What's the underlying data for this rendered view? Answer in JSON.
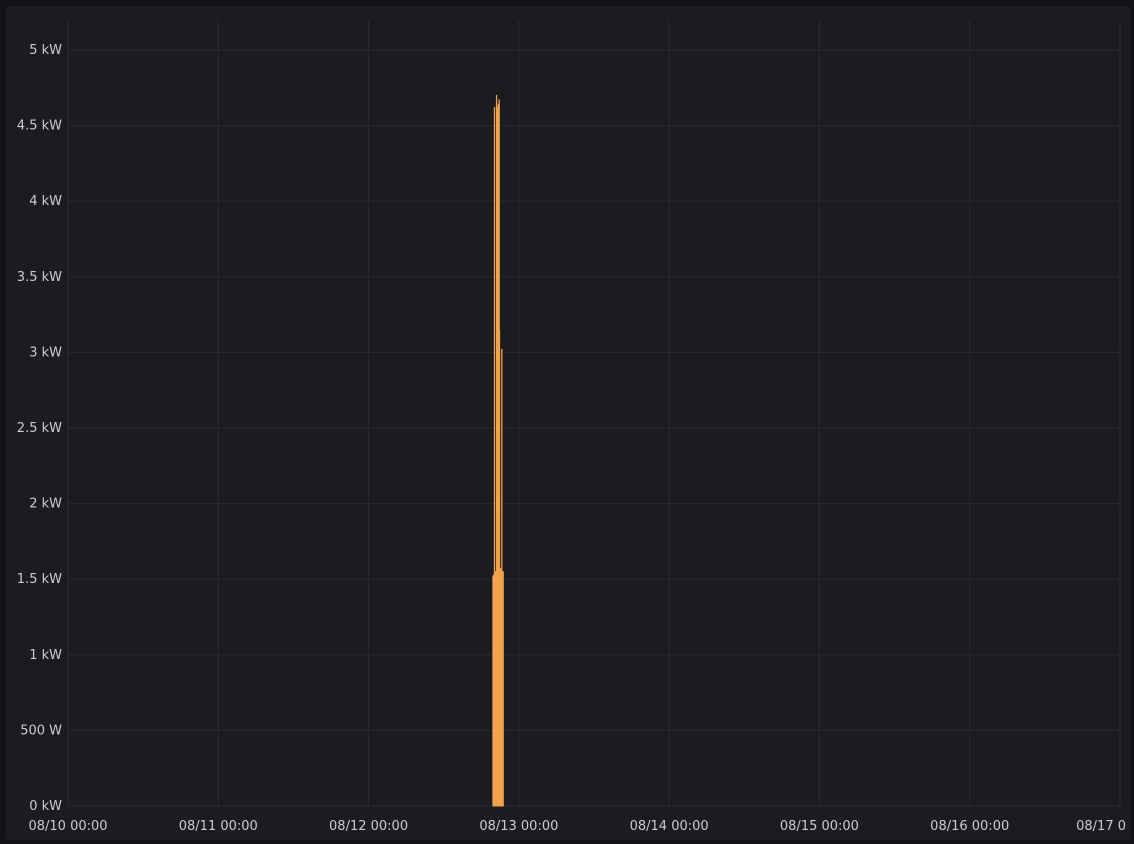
{
  "chart_data": {
    "type": "area",
    "title": "",
    "xlabel": "",
    "ylabel": "",
    "series": [
      {
        "color": "#f2a24b",
        "points": [
          {
            "x": "08/12 19:50",
            "y": 0
          },
          {
            "x": "08/12 19:51",
            "y": 1520
          },
          {
            "x": "08/12 20:00",
            "y": 1530
          },
          {
            "x": "08/12 20:05",
            "y": 4620
          },
          {
            "x": "08/12 20:08",
            "y": 1540
          },
          {
            "x": "08/12 20:15",
            "y": 1550
          },
          {
            "x": "08/12 20:25",
            "y": 4700
          },
          {
            "x": "08/12 20:28",
            "y": 1560
          },
          {
            "x": "08/12 20:35",
            "y": 4620
          },
          {
            "x": "08/12 20:38",
            "y": 1570
          },
          {
            "x": "08/12 20:42",
            "y": 4640
          },
          {
            "x": "08/12 20:45",
            "y": 1560
          },
          {
            "x": "08/12 20:50",
            "y": 4670
          },
          {
            "x": "08/12 20:53",
            "y": 3140
          },
          {
            "x": "08/12 20:56",
            "y": 1570
          },
          {
            "x": "08/12 21:05",
            "y": 1560
          },
          {
            "x": "08/12 21:10",
            "y": 1560
          },
          {
            "x": "08/12 21:15",
            "y": 3020
          },
          {
            "x": "08/12 21:18",
            "y": 1550
          },
          {
            "x": "08/12 21:30",
            "y": 1550
          },
          {
            "x": "08/12 21:31",
            "y": 0
          }
        ]
      }
    ],
    "x_ticks": [
      "08/10 00:00",
      "08/11 00:00",
      "08/12 00:00",
      "08/13 00:00",
      "08/14 00:00",
      "08/15 00:00",
      "08/16 00:00",
      "08/17 0"
    ],
    "y_ticks": [
      {
        "value": 0,
        "label": "0 kW"
      },
      {
        "value": 500,
        "label": "500 W"
      },
      {
        "value": 1000,
        "label": "1 kW"
      },
      {
        "value": 1500,
        "label": "1.5 kW"
      },
      {
        "value": 2000,
        "label": "2 kW"
      },
      {
        "value": 2500,
        "label": "2.5 kW"
      },
      {
        "value": 3000,
        "label": "3 kW"
      },
      {
        "value": 3500,
        "label": "3.5 kW"
      },
      {
        "value": 4000,
        "label": "4 kW"
      },
      {
        "value": 4500,
        "label": "4.5 kW"
      },
      {
        "value": 5000,
        "label": "5 kW"
      }
    ],
    "ylim": [
      0,
      5000
    ],
    "xlim": [
      "08/10 00:00",
      "08/17 00:00"
    ],
    "grid": true,
    "legend": "none"
  }
}
